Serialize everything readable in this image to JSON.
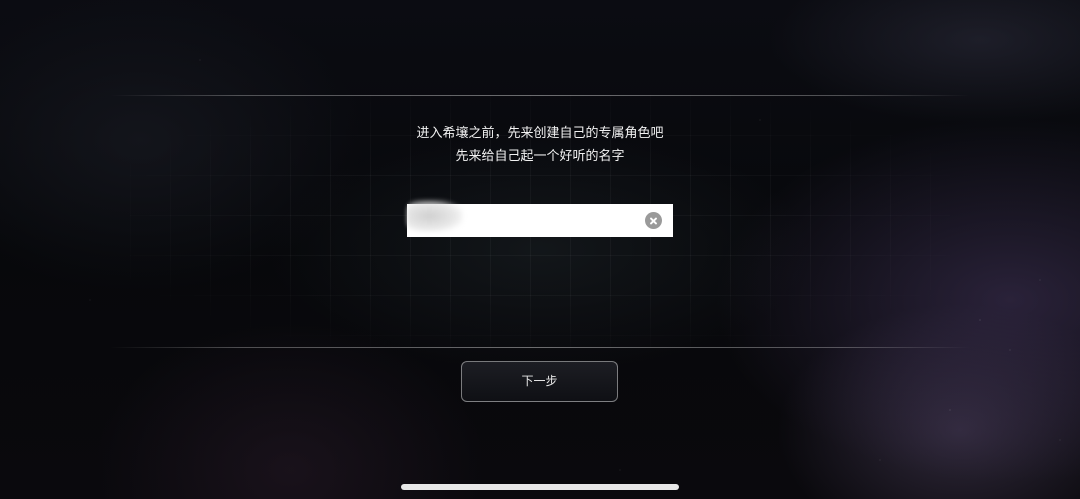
{
  "prompt": {
    "line1": "进入希壤之前，先来创建自己的专属角色吧",
    "line2": "先来给自己起一个好听的名字"
  },
  "name_input": {
    "value": "",
    "clear_icon": "clear-circle-icon"
  },
  "next_button": {
    "label": "下一步"
  },
  "colors": {
    "text": "#f2f2f2",
    "input_bg": "#ffffff",
    "clear_icon": "#9a9a9a",
    "button_border": "#d2d2d2"
  }
}
